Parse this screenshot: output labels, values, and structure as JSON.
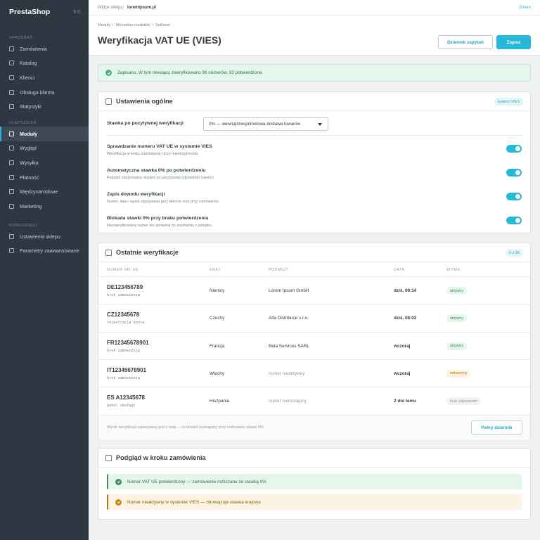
{
  "sidebar": {
    "brand": "PrestaShop",
    "version": "9.0",
    "sections": [
      {
        "title": "SPRZEDAŻ",
        "items": [
          "Zamówienia",
          "Katalog",
          "Klienci",
          "Obsługa klienta",
          "Statystyki"
        ]
      },
      {
        "title": "ULEPSZENIA",
        "items": [
          "Moduły",
          "Wygląd",
          "Wysyłka",
          "Płatność",
          "Międzynarodowe",
          "Marketing"
        ]
      },
      {
        "title": "KONFIGURUJ",
        "items": [
          "Ustawienia sklepu",
          "Parametry zaawansowane"
        ]
      }
    ],
    "active_item": "Moduły"
  },
  "topbar": {
    "shop_label": "Widok sklepu:",
    "shop_url": "loremipsum.pl",
    "change_link": "Zmień"
  },
  "header": {
    "breadcrumb": [
      "Moduły",
      "Menedżer modułów",
      "Sellision"
    ],
    "title": "Weryfikacja VAT UE (VIES)",
    "log_button": "Dziennik zapytań",
    "save_button": "Zapisz"
  },
  "alert": {
    "text": "Zapisano. W tym miesiącu zweryfikowano 96 numerów, 92 potwierdzone."
  },
  "general": {
    "title": "Ustawienia ogólne",
    "tag": "system VIES",
    "rate_label": "Stawka po pozytywnej weryfikacji",
    "rate_value": "0% — wewnątrzwspólnotowa dostawa towarów",
    "settings": [
      {
        "title": "Sprawdzanie numeru VAT UE w systemie VIES",
        "desc": "Weryfikacja w kroku zamówienia i przy rejestracji konta.",
        "enabled": true
      },
      {
        "title": "Automatyczna stawka 0% po potwierdzeniu",
        "desc": "Podatek zdejmowany dopiero po pozytywnej odpowiedzi rejestru.",
        "enabled": true
      },
      {
        "title": "Zapis dowodu weryfikacji",
        "desc": "Numer, data i wynik zapisywane przy kliencie oraz przy zamówieniu.",
        "enabled": true
      },
      {
        "title": "Blokada stawki 0% przy braku potwierdzenia",
        "desc": "Niezweryfikowany numer nie uprawnia do zwolnienia z podatku.",
        "enabled": true
      }
    ]
  },
  "recent": {
    "title": "Ostatnie weryfikacje",
    "count": "5 z 96",
    "columns": [
      "NUMER VAT UE",
      "KRAJ",
      "PODMIOT",
      "DATA",
      "WYNIK"
    ],
    "rows": [
      {
        "vat": "DE123456789",
        "source": "krok zamówienia",
        "country": "Niemcy",
        "entity": "Lorem Ipsum GmbH",
        "entity_muted": false,
        "date": "dziś, 09:14",
        "result": "aktywny",
        "result_type": "green"
      },
      {
        "vat": "CZ12345678",
        "source": "rejestracja konta",
        "country": "Czechy",
        "entity": "Alfa Distribuce s.r.o.",
        "entity_muted": false,
        "date": "dziś, 08:02",
        "result": "aktywny",
        "result_type": "green"
      },
      {
        "vat": "FR12345678901",
        "source": "krok zamówienia",
        "country": "Francja",
        "entity": "Beta Services SARL",
        "entity_muted": false,
        "date": "wczoraj",
        "result": "aktywny",
        "result_type": "green"
      },
      {
        "vat": "IT12345678901",
        "source": "krok zamówienia",
        "country": "Włochy",
        "entity": "numer nieaktywny",
        "entity_muted": true,
        "date": "wczoraj",
        "result": "odrzucony",
        "result_type": "orange"
      },
      {
        "vat": "ES A12345678",
        "source": "panel obsługi",
        "country": "Hiszpania",
        "entity": "rejestr niedostępny",
        "entity_muted": true,
        "date": "2 dni temu",
        "result": "brak odpowiedzi",
        "result_type": "grey"
      }
    ],
    "footer_note": "Wynik weryfikacji zapisywany jest z datą — to dowód wymagany przy rozliczaniu stawki 0%.",
    "full_log_button": "Pełny dziennik"
  },
  "preview": {
    "title": "Podgląd w kroku zamówienia",
    "ok_message": "Numer VAT UE potwierdzony — zamówienie rozliczane ze stawką 0%",
    "warn_message": "Numer nieaktywny w systemie VIES — obowiązuje stawka krajowa"
  },
  "colors": {
    "accent": "#25b9d7",
    "sidebar": "#2f3742",
    "success": "#3f8f5f",
    "warning": "#b4780f"
  }
}
